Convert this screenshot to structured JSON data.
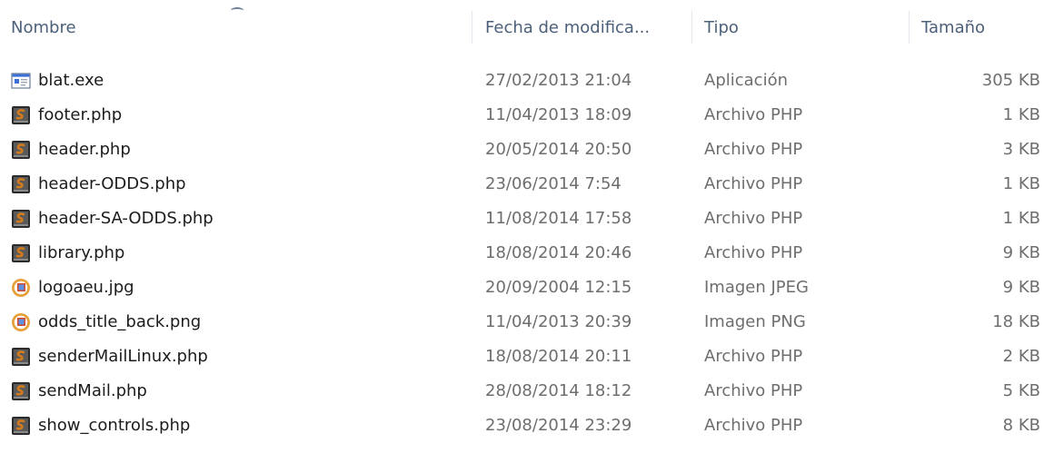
{
  "columns": {
    "name": "Nombre",
    "date": "Fecha de modifica...",
    "type": "Tipo",
    "size": "Tamaño"
  },
  "icon_colors": {
    "php_frame": "#2b2b2b",
    "php_accent": "#d27a1e",
    "exe_blue": "#3a6fd8",
    "image_orange": "#e8a13a"
  },
  "files": [
    {
      "name": "blat.exe",
      "date": "27/02/2013 21:04",
      "type": "Aplicación",
      "size": "305 KB",
      "icon": "exe-icon"
    },
    {
      "name": "footer.php",
      "date": "11/04/2013 18:09",
      "type": "Archivo PHP",
      "size": "1 KB",
      "icon": "php-file-icon"
    },
    {
      "name": "header.php",
      "date": "20/05/2014 20:50",
      "type": "Archivo PHP",
      "size": "3 KB",
      "icon": "php-file-icon"
    },
    {
      "name": "header-ODDS.php",
      "date": "23/06/2014 7:54",
      "type": "Archivo PHP",
      "size": "1 KB",
      "icon": "php-file-icon"
    },
    {
      "name": "header-SA-ODDS.php",
      "date": "11/08/2014 17:58",
      "type": "Archivo PHP",
      "size": "1 KB",
      "icon": "php-file-icon"
    },
    {
      "name": "library.php",
      "date": "18/08/2014 20:46",
      "type": "Archivo PHP",
      "size": "9 KB",
      "icon": "php-file-icon"
    },
    {
      "name": "logoaeu.jpg",
      "date": "20/09/2004 12:15",
      "type": "Imagen JPEG",
      "size": "9 KB",
      "icon": "image-file-icon"
    },
    {
      "name": "odds_title_back.png",
      "date": "11/04/2013 20:39",
      "type": "Imagen PNG",
      "size": "18 KB",
      "icon": "image-file-icon"
    },
    {
      "name": "senderMailLinux.php",
      "date": "18/08/2014 20:11",
      "type": "Archivo PHP",
      "size": "2 KB",
      "icon": "php-file-icon"
    },
    {
      "name": "sendMail.php",
      "date": "28/08/2014 18:12",
      "type": "Archivo PHP",
      "size": "5 KB",
      "icon": "php-file-icon"
    },
    {
      "name": "show_controls.php",
      "date": "23/08/2014 23:29",
      "type": "Archivo PHP",
      "size": "8 KB",
      "icon": "php-file-icon"
    }
  ]
}
